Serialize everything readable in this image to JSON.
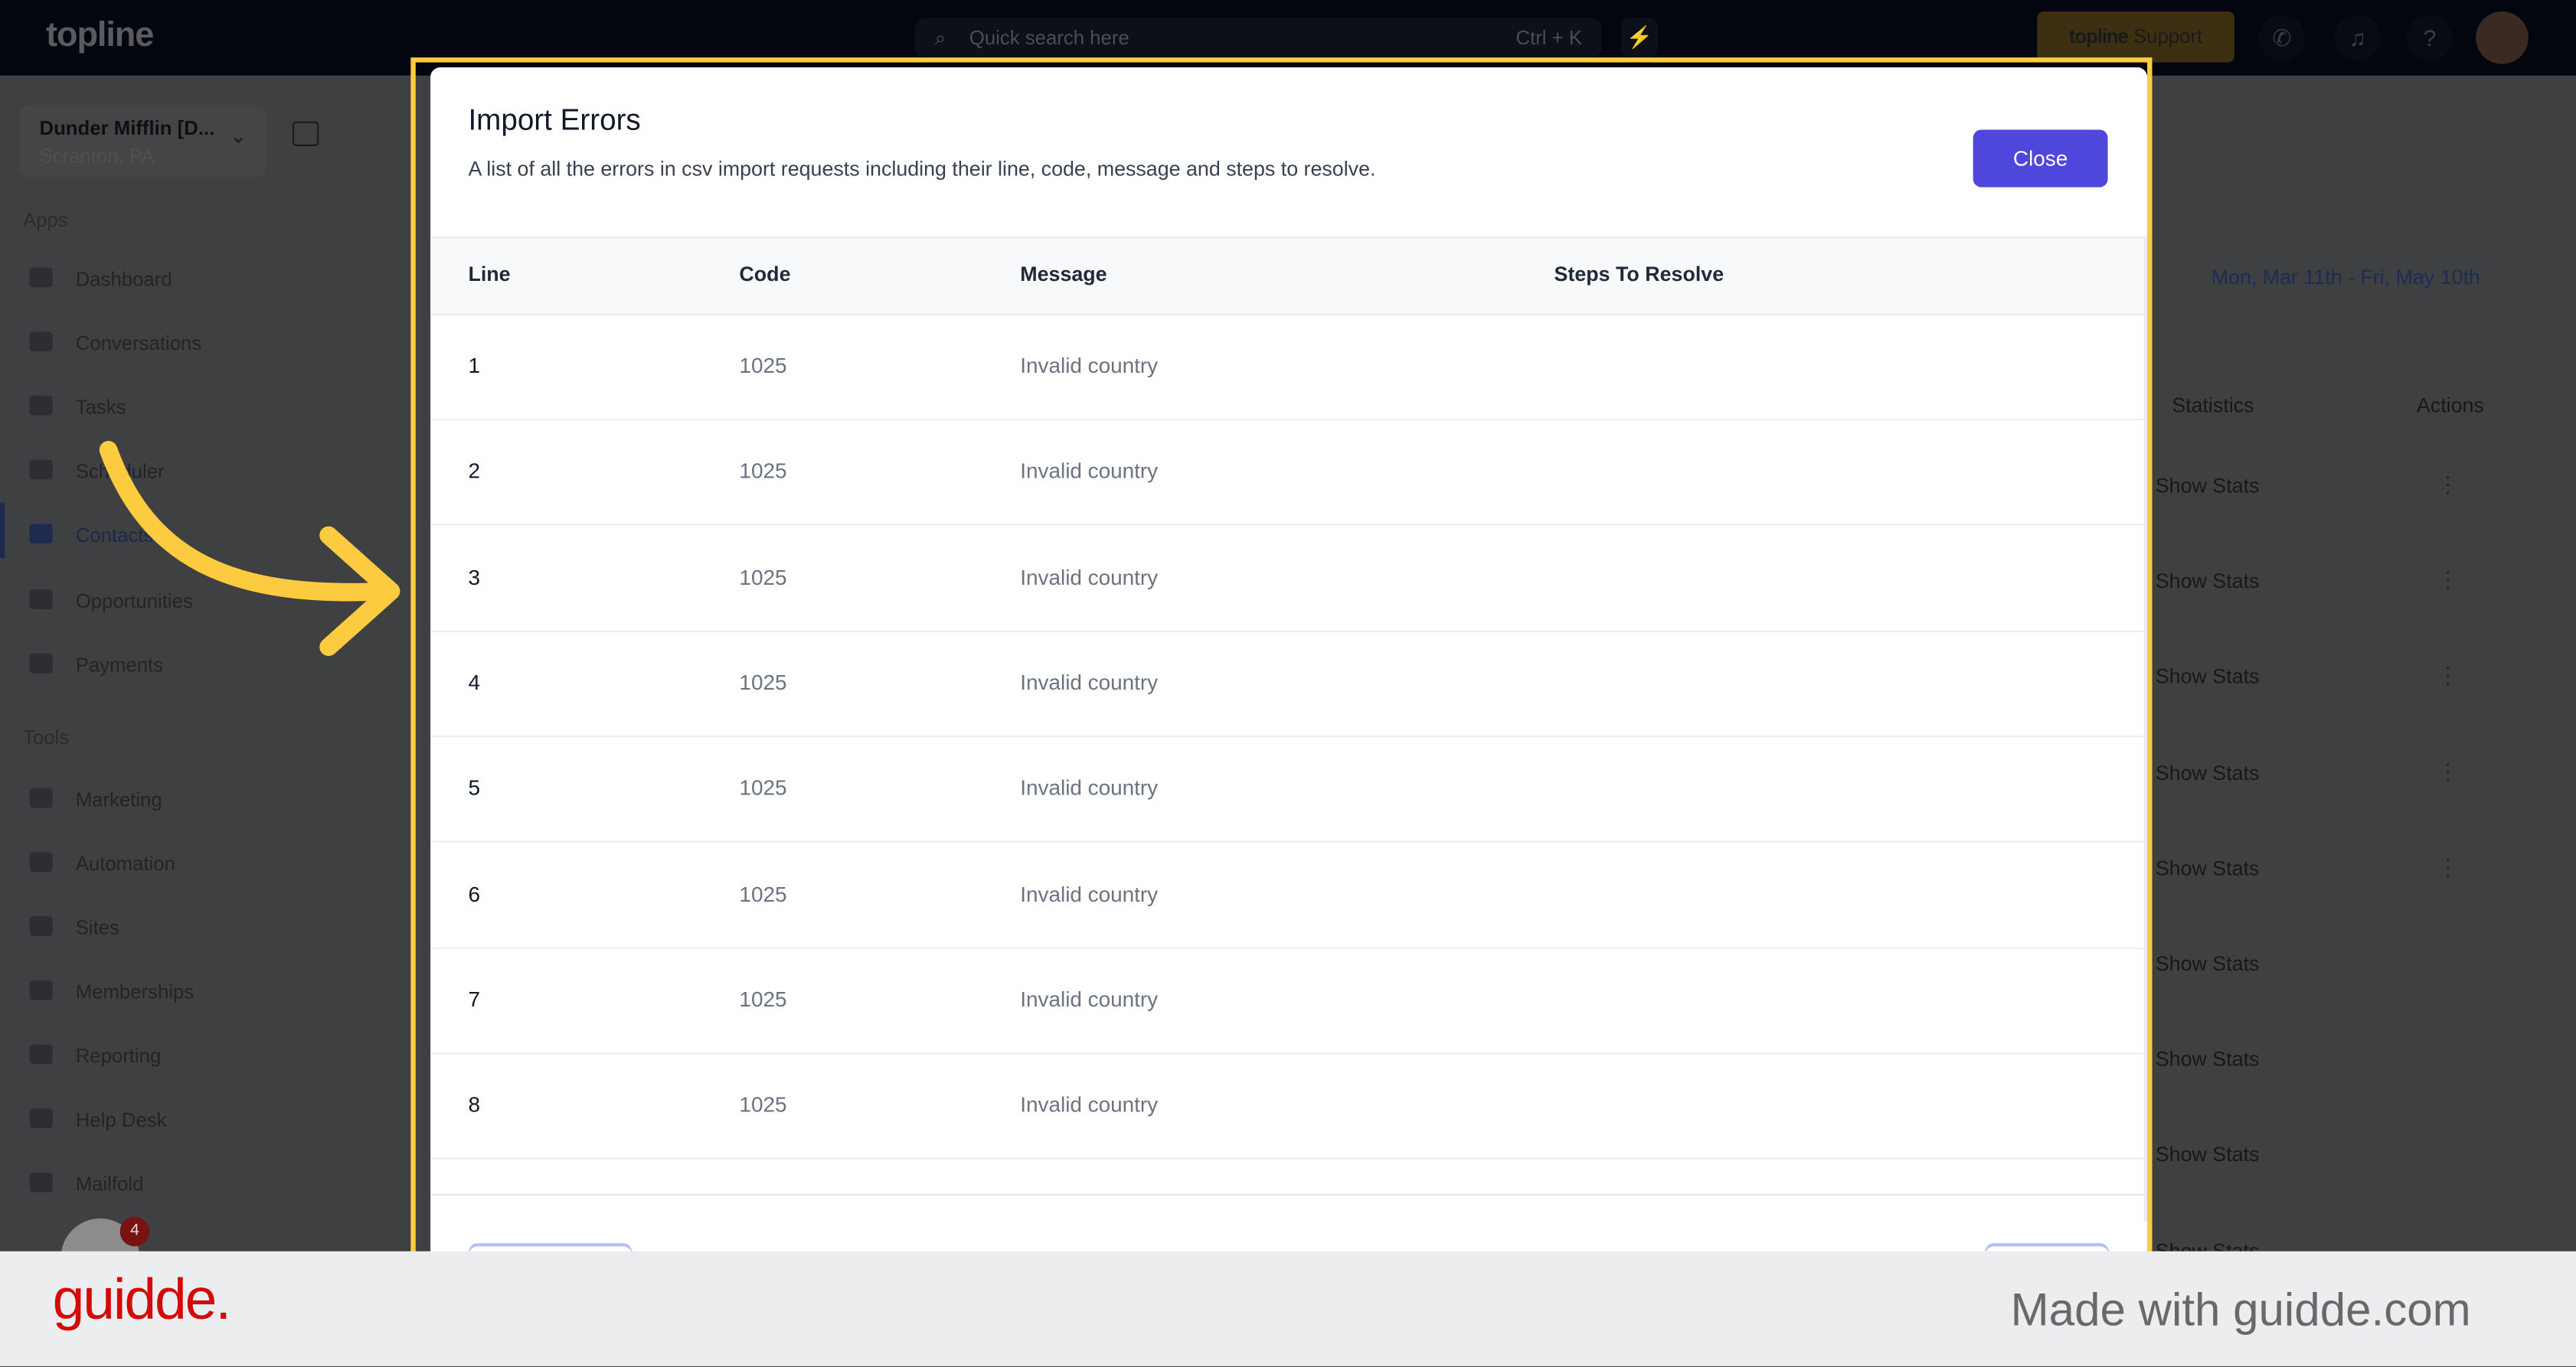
{
  "topbar": {
    "logo": "topline",
    "search_placeholder": "Quick search here",
    "search_shortcut": "Ctrl + K",
    "support_brand": "topline",
    "support_label": "Support",
    "icons": [
      "search-icon",
      "lightning-icon",
      "phone-icon",
      "bell-icon",
      "help-icon",
      "avatar"
    ]
  },
  "sidebar": {
    "account_name": "Dunder Mifflin [D...",
    "account_location": "Scranton, PA",
    "apps_heading": "Apps",
    "apps": [
      {
        "label": "Dashboard"
      },
      {
        "label": "Conversations"
      },
      {
        "label": "Tasks"
      },
      {
        "label": "Scheduler"
      },
      {
        "label": "Contacts",
        "active": true
      },
      {
        "label": "Opportunities"
      },
      {
        "label": "Payments"
      }
    ],
    "tools_heading": "Tools",
    "tools": [
      {
        "label": "Marketing"
      },
      {
        "label": "Automation"
      },
      {
        "label": "Sites"
      },
      {
        "label": "Memberships"
      },
      {
        "label": "Reporting"
      },
      {
        "label": "Help Desk"
      },
      {
        "label": "Mailfold"
      }
    ],
    "chat_badge": "4"
  },
  "background": {
    "date_range": "Mon, Mar 11th - Fri, May 10th",
    "col_statistics": "Statistics",
    "col_actions": "Actions",
    "show_stats": "Show Stats"
  },
  "modal": {
    "title": "Import Errors",
    "description": "A list of all the errors in csv import requests including their line, code, message and steps to resolve.",
    "close_label": "Close",
    "columns": [
      "Line",
      "Code",
      "Message",
      "Steps To Resolve"
    ],
    "rows": [
      {
        "line": "1",
        "code": "1025",
        "message": "Invalid country",
        "steps": ""
      },
      {
        "line": "2",
        "code": "1025",
        "message": "Invalid country",
        "steps": ""
      },
      {
        "line": "3",
        "code": "1025",
        "message": "Invalid country",
        "steps": ""
      },
      {
        "line": "4",
        "code": "1025",
        "message": "Invalid country",
        "steps": ""
      },
      {
        "line": "5",
        "code": "1025",
        "message": "Invalid country",
        "steps": ""
      },
      {
        "line": "6",
        "code": "1025",
        "message": "Invalid country",
        "steps": ""
      },
      {
        "line": "7",
        "code": "1025",
        "message": "Invalid country",
        "steps": ""
      },
      {
        "line": "8",
        "code": "1025",
        "message": "Invalid country",
        "steps": ""
      }
    ]
  },
  "highlight_color": "#fdcb3f",
  "accent_color": "#4f46dc",
  "watermark": {
    "logo": "guidde.",
    "text": "Made with guidde.com"
  }
}
